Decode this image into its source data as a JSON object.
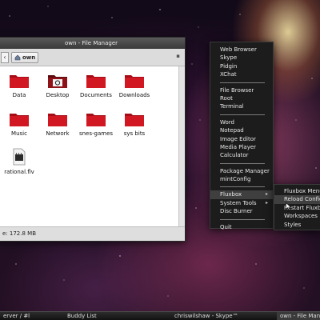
{
  "file_manager": {
    "title": "own - File Manager",
    "back_label": "‹",
    "breadcrumb_label": "own",
    "pin_label": "▪",
    "items": [
      {
        "label": "Data",
        "icon": "folder-icon"
      },
      {
        "label": "Desktop",
        "icon": "desktop-folder-icon"
      },
      {
        "label": "Documents",
        "icon": "folder-icon"
      },
      {
        "label": "Downloads",
        "icon": "folder-icon"
      },
      {
        "label": "Music",
        "icon": "folder-icon"
      },
      {
        "label": "Network",
        "icon": "folder-icon"
      },
      {
        "label": "snes-games",
        "icon": "folder-icon"
      },
      {
        "label": "sys bits",
        "icon": "folder-icon"
      },
      {
        "label": "rational.flv",
        "icon": "video-file-icon"
      }
    ],
    "status": "e: 172.8 MB"
  },
  "root_menu": {
    "group1": [
      "Web Browser",
      "Skype",
      "Pidgin",
      "XChat"
    ],
    "group2": [
      "File Browser",
      "Root",
      "Terminal"
    ],
    "group3": [
      "Word",
      "Notepad",
      "Image Editor",
      "Media Player",
      "Calculator"
    ],
    "group4": [
      "Package Manager",
      "mintConfig"
    ],
    "group5": [
      {
        "label": "Fluxbox",
        "arrow": "▸"
      },
      {
        "label": "System Tools",
        "arrow": "▸"
      },
      {
        "label": "Disc Burner",
        "arrow": ""
      }
    ],
    "quit": "Quit"
  },
  "fluxbox_menu": {
    "items": [
      "Fluxbox Menu",
      "Reload Config",
      "Restart Fluxbox",
      "Workspaces",
      "Styles"
    ]
  },
  "taskbar": {
    "tasks": [
      "erver / #l",
      "Buddy List",
      "chriswilshaw - Skype™",
      "own - File Manager"
    ]
  },
  "colors": {
    "folder_red": "#c8101c",
    "menu_bg": "#1c1c1c",
    "menu_highlight": "#3f3f3f"
  }
}
